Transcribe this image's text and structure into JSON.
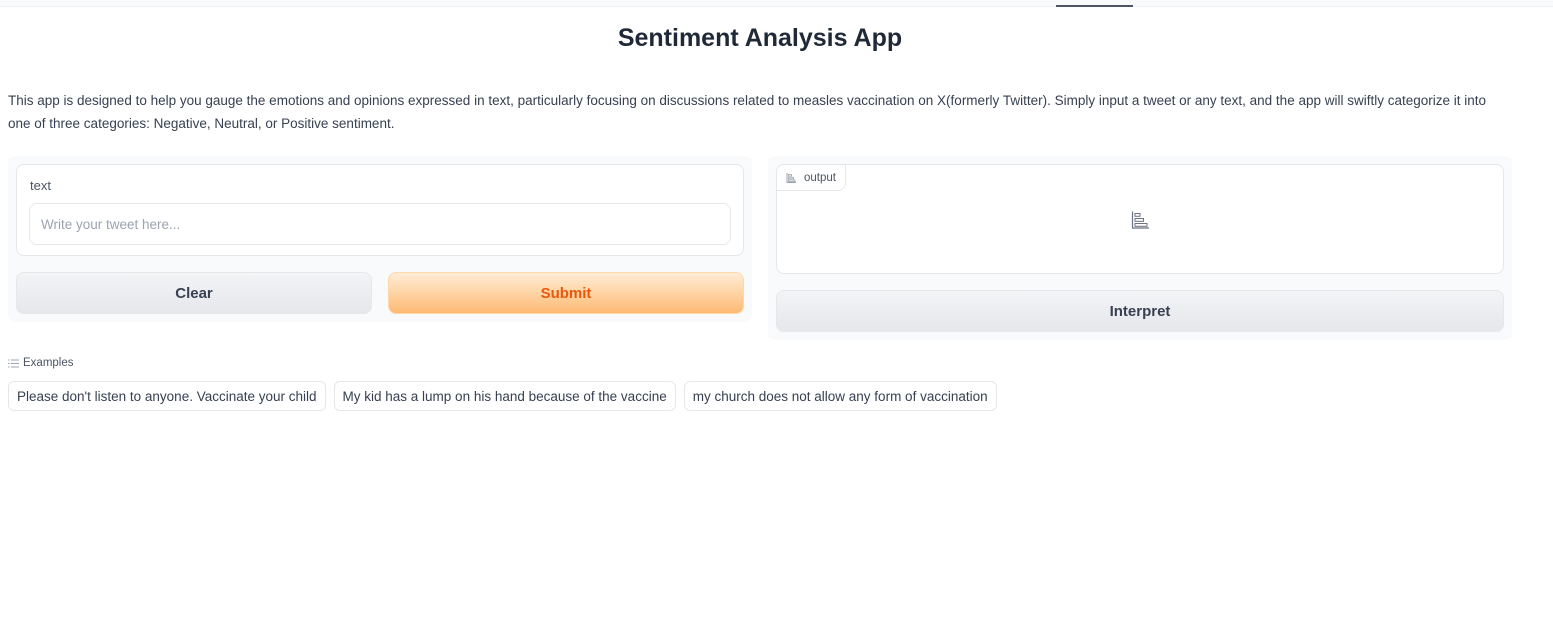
{
  "app": {
    "title": "Sentiment Analysis App",
    "description": "This app is designed to help you gauge the emotions and opinions expressed in text, particularly focusing on discussions related to measles vaccination on X(formerly Twitter). Simply input a tweet or any text, and the app will swiftly categorize it into one of three categories: Negative, Neutral, or Positive sentiment."
  },
  "input": {
    "label": "text",
    "placeholder": "Write your tweet here...",
    "value": ""
  },
  "buttons": {
    "clear": "Clear",
    "submit": "Submit",
    "interpret": "Interpret"
  },
  "output": {
    "label": "output",
    "icon": "bar-chart-icon"
  },
  "examples": {
    "label": "Examples",
    "icon": "list-icon",
    "items": [
      "Please don't listen to anyone. Vaccinate your child",
      "My kid has a lump on his hand because of the vaccine",
      "my church does not allow any form of vaccination"
    ]
  },
  "colors": {
    "submit_text": "#ea580c",
    "submit_bg_start": "#ffedd5",
    "submit_bg_end": "#fdba74",
    "panel_bg": "#f9fafb",
    "border": "#e5e7eb"
  }
}
